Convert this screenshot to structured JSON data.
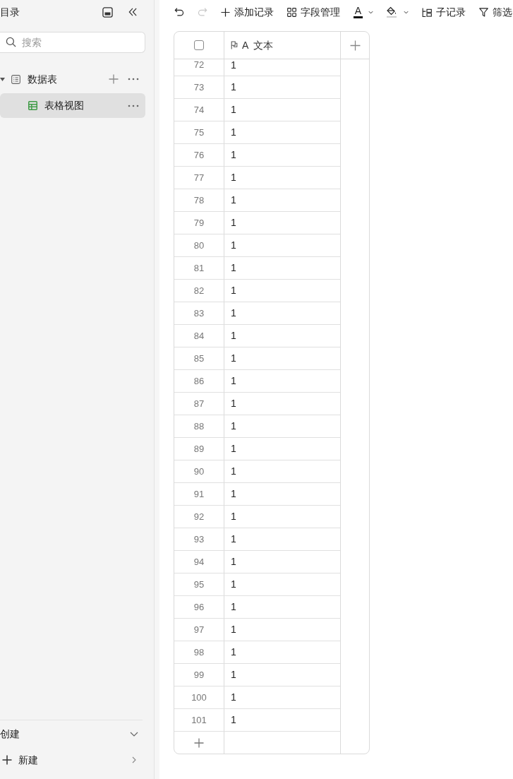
{
  "sidebar": {
    "title": "目录",
    "search": {
      "placeholder": "搜索"
    },
    "tree": [
      {
        "label": "数据表",
        "expanded": true,
        "children": [
          {
            "label": "表格视图",
            "selected": true
          }
        ]
      }
    ],
    "create": {
      "title": "创建",
      "expanded": true,
      "items": [
        {
          "label": "新建"
        }
      ]
    }
  },
  "toolbar": [
    {
      "kind": "undo",
      "disabled": false
    },
    {
      "kind": "redo",
      "disabled": true
    },
    {
      "kind": "add_record",
      "label": "添加记录",
      "disabled": false
    },
    {
      "kind": "field_manager",
      "label": "字段管理",
      "disabled": false
    },
    {
      "kind": "text_color",
      "glyph": "A",
      "disabled": false
    },
    {
      "kind": "fill_color",
      "disabled": false
    },
    {
      "kind": "sub_record",
      "label": "子记录",
      "disabled": false
    },
    {
      "kind": "filter",
      "label": "筛选",
      "disabled": false
    }
  ],
  "table": {
    "columns": [
      {
        "kind": "select",
        "checked": false
      },
      {
        "kind": "text",
        "primary": true,
        "type_glyph": "A",
        "label": "文本"
      },
      {
        "kind": "add"
      }
    ],
    "rows": [
      {
        "number": "72",
        "cells": [
          "1"
        ]
      },
      {
        "number": "73",
        "cells": [
          "1"
        ]
      },
      {
        "number": "74",
        "cells": [
          "1"
        ]
      },
      {
        "number": "75",
        "cells": [
          "1"
        ]
      },
      {
        "number": "76",
        "cells": [
          "1"
        ]
      },
      {
        "number": "77",
        "cells": [
          "1"
        ]
      },
      {
        "number": "78",
        "cells": [
          "1"
        ]
      },
      {
        "number": "79",
        "cells": [
          "1"
        ]
      },
      {
        "number": "80",
        "cells": [
          "1"
        ]
      },
      {
        "number": "81",
        "cells": [
          "1"
        ]
      },
      {
        "number": "82",
        "cells": [
          "1"
        ]
      },
      {
        "number": "83",
        "cells": [
          "1"
        ]
      },
      {
        "number": "84",
        "cells": [
          "1"
        ]
      },
      {
        "number": "85",
        "cells": [
          "1"
        ]
      },
      {
        "number": "86",
        "cells": [
          "1"
        ]
      },
      {
        "number": "87",
        "cells": [
          "1"
        ]
      },
      {
        "number": "88",
        "cells": [
          "1"
        ]
      },
      {
        "number": "89",
        "cells": [
          "1"
        ]
      },
      {
        "number": "90",
        "cells": [
          "1"
        ]
      },
      {
        "number": "91",
        "cells": [
          "1"
        ]
      },
      {
        "number": "92",
        "cells": [
          "1"
        ]
      },
      {
        "number": "93",
        "cells": [
          "1"
        ]
      },
      {
        "number": "94",
        "cells": [
          "1"
        ]
      },
      {
        "number": "95",
        "cells": [
          "1"
        ]
      },
      {
        "number": "96",
        "cells": [
          "1"
        ]
      },
      {
        "number": "97",
        "cells": [
          "1"
        ]
      },
      {
        "number": "98",
        "cells": [
          "1"
        ]
      },
      {
        "number": "99",
        "cells": [
          "1"
        ]
      },
      {
        "number": "100",
        "cells": [
          "1"
        ]
      },
      {
        "number": "101",
        "cells": [
          "1"
        ]
      }
    ]
  }
}
